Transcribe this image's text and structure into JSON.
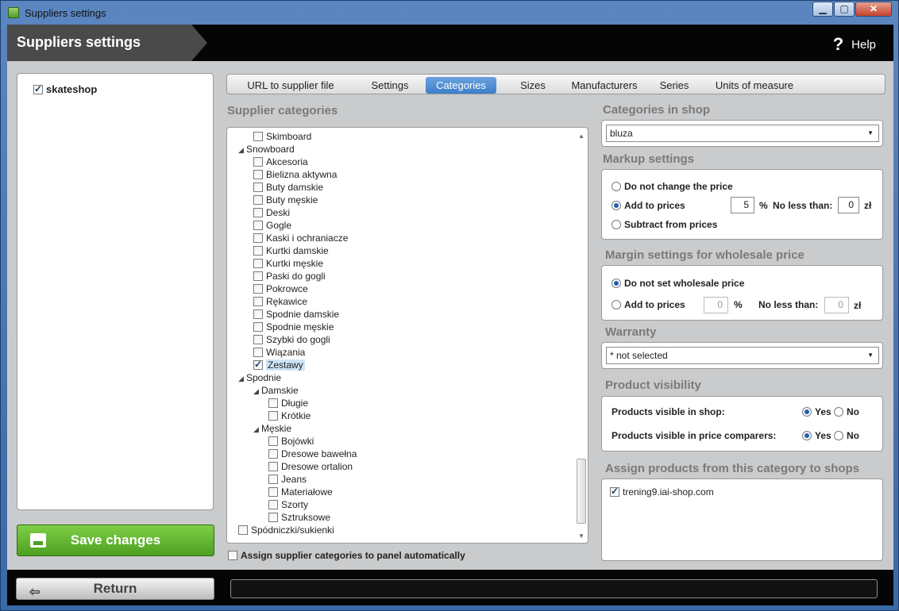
{
  "window": {
    "title": "Suppliers settings",
    "min": "▁",
    "max": "▢",
    "close": "✕"
  },
  "header": {
    "title": "Suppliers settings",
    "help_icon": "?",
    "help_label": "Help"
  },
  "shops": [
    {
      "name": "skateshop",
      "checked": true
    }
  ],
  "save_label": "Save changes",
  "tabs": [
    "URL to supplier file",
    "Settings",
    "Categories",
    "Sizes",
    "Manufacturers",
    "Series",
    "Units of measure"
  ],
  "active_tab": "Categories",
  "supplier_categories": {
    "title": "Supplier categories",
    "tree": [
      {
        "label": "Skimboard",
        "level": 2,
        "checkbox": true,
        "checked": false
      },
      {
        "label": "Snowboard",
        "level": 1,
        "expander": true
      },
      {
        "label": "Akcesoria",
        "level": 2,
        "checkbox": true,
        "checked": false
      },
      {
        "label": "Bielizna aktywna",
        "level": 2,
        "checkbox": true,
        "checked": false
      },
      {
        "label": "Buty damskie",
        "level": 2,
        "checkbox": true,
        "checked": false
      },
      {
        "label": "Buty męskie",
        "level": 2,
        "checkbox": true,
        "checked": false
      },
      {
        "label": "Deski",
        "level": 2,
        "checkbox": true,
        "checked": false
      },
      {
        "label": "Gogle",
        "level": 2,
        "checkbox": true,
        "checked": false
      },
      {
        "label": "Kaski i ochraniacze",
        "level": 2,
        "checkbox": true,
        "checked": false
      },
      {
        "label": "Kurtki damskie",
        "level": 2,
        "checkbox": true,
        "checked": false
      },
      {
        "label": "Kurtki męskie",
        "level": 2,
        "checkbox": true,
        "checked": false
      },
      {
        "label": "Paski do gogli",
        "level": 2,
        "checkbox": true,
        "checked": false
      },
      {
        "label": "Pokrowce",
        "level": 2,
        "checkbox": true,
        "checked": false
      },
      {
        "label": "Rękawice",
        "level": 2,
        "checkbox": true,
        "checked": false
      },
      {
        "label": "Spodnie damskie",
        "level": 2,
        "checkbox": true,
        "checked": false
      },
      {
        "label": "Spodnie męskie",
        "level": 2,
        "checkbox": true,
        "checked": false
      },
      {
        "label": "Szybki do gogli",
        "level": 2,
        "checkbox": true,
        "checked": false
      },
      {
        "label": "Wiązania",
        "level": 2,
        "checkbox": true,
        "checked": false
      },
      {
        "label": "Zestawy",
        "level": 2,
        "checkbox": true,
        "checked": true,
        "selected": true
      },
      {
        "label": "Spodnie",
        "level": 1,
        "expander": true
      },
      {
        "label": "Damskie",
        "level": 2,
        "expander": true
      },
      {
        "label": "Długie",
        "level": 3,
        "checkbox": true,
        "checked": false
      },
      {
        "label": "Krótkie",
        "level": 3,
        "checkbox": true,
        "checked": false
      },
      {
        "label": "Męskie",
        "level": 2,
        "expander": true
      },
      {
        "label": "Bojówki",
        "level": 3,
        "checkbox": true,
        "checked": false
      },
      {
        "label": "Dresowe bawełna",
        "level": 3,
        "checkbox": true,
        "checked": false
      },
      {
        "label": "Dresowe ortalion",
        "level": 3,
        "checkbox": true,
        "checked": false
      },
      {
        "label": "Jeans",
        "level": 3,
        "checkbox": true,
        "checked": false
      },
      {
        "label": "Materiałowe",
        "level": 3,
        "checkbox": true,
        "checked": false
      },
      {
        "label": "Szorty",
        "level": 3,
        "checkbox": true,
        "checked": false
      },
      {
        "label": "Sztruksowe",
        "level": 3,
        "checkbox": true,
        "checked": false
      },
      {
        "label": "Spódniczki/sukienki",
        "level": 1,
        "checkbox": true,
        "checked": false
      }
    ],
    "auto_assign_label": "Assign supplier categories to panel automatically"
  },
  "categories_in_shop": {
    "title": "Categories in shop",
    "selected": "bluza"
  },
  "markup": {
    "title": "Markup settings",
    "opt_nochange": "Do not change the price",
    "opt_add": "Add to prices",
    "opt_subtract": "Subtract from prices",
    "selected": "add",
    "percent_value": "5",
    "percent_unit": "%",
    "no_less_label": "No less than:",
    "no_less_value": "0",
    "currency": "zł"
  },
  "margin": {
    "title": "Margin settings for wholesale price",
    "opt_notset": "Do not set wholesale price",
    "opt_add": "Add to prices",
    "selected": "notset",
    "percent_value": "0",
    "percent_unit": "%",
    "no_less_label": "No less than:",
    "no_less_value": "0",
    "currency": "zł"
  },
  "warranty": {
    "title": "Warranty",
    "selected": "* not selected"
  },
  "visibility": {
    "title": "Product visibility",
    "shop_label": "Products visible in shop:",
    "comparers_label": "Products visible in price comparers:",
    "yes": "Yes",
    "no": "No",
    "shop_value": "yes",
    "comparers_value": "yes"
  },
  "assign_shops": {
    "title": "Assign products from this category to shops",
    "items": [
      {
        "name": "trening9.iai-shop.com",
        "checked": true
      }
    ]
  },
  "footer": {
    "return_icon": "⇦",
    "return_label": "Return"
  },
  "colors": {
    "accent": "#3d7fcb",
    "save": "#5aa92a",
    "header": "#050505"
  }
}
